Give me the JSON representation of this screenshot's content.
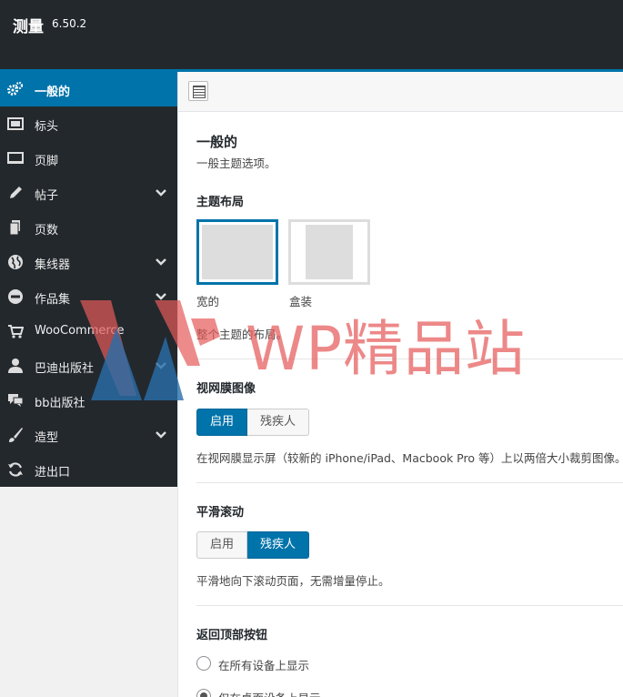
{
  "header": {
    "title": "测量",
    "version": "6.50.2"
  },
  "sidebar": {
    "items": [
      {
        "label": "一般的",
        "icon": "gears-icon",
        "active": true,
        "has_children": false
      },
      {
        "label": "标头",
        "icon": "header-icon",
        "active": false,
        "has_children": false
      },
      {
        "label": "页脚",
        "icon": "footer-icon",
        "active": false,
        "has_children": false
      },
      {
        "label": "帖子",
        "icon": "pencil-icon",
        "active": false,
        "has_children": true
      },
      {
        "label": "页数",
        "icon": "pages-icon",
        "active": false,
        "has_children": false
      },
      {
        "label": "集线器",
        "icon": "globe-icon",
        "active": false,
        "has_children": true
      },
      {
        "label": "作品集",
        "icon": "portfolio-icon",
        "active": false,
        "has_children": true
      },
      {
        "label": "WooCommerce",
        "icon": "cart-icon",
        "active": false,
        "has_children": false
      },
      {
        "label": "巴迪出版社",
        "icon": "user-icon",
        "active": false,
        "has_children": true
      },
      {
        "label": "bb出版社",
        "icon": "comments-icon",
        "active": false,
        "has_children": false
      },
      {
        "label": "造型",
        "icon": "brush-icon",
        "active": false,
        "has_children": true
      },
      {
        "label": "进出口",
        "icon": "refresh-icon",
        "active": false,
        "has_children": false
      }
    ]
  },
  "main": {
    "section_title": "一般的",
    "section_desc": "一般主题选项。",
    "layout": {
      "label": "主题布局",
      "options": [
        {
          "label": "宽的",
          "selected": true
        },
        {
          "label": "盒装",
          "selected": false
        }
      ],
      "desc": "整个主题的布局。"
    },
    "retina": {
      "label": "视网膜图像",
      "on_label": "启用",
      "off_label": "残疾人",
      "state": "on",
      "desc": "在视网膜显示屏（较新的 iPhone/iPad、Macbook Pro 等）上以两倍大小裁剪图像。"
    },
    "smooth": {
      "label": "平滑滚动",
      "on_label": "启用",
      "off_label": "残疾人",
      "state": "off",
      "desc": "平滑地向下滚动页面，无需增量停止。"
    },
    "back_to_top": {
      "label": "返回顶部按钮",
      "options": [
        {
          "label": "在所有设备上显示",
          "checked": false
        },
        {
          "label": "仅在桌面设备上显示",
          "checked": true
        }
      ]
    }
  },
  "watermark": {
    "text": "WP精品站"
  },
  "colors": {
    "accent": "#0073aa",
    "sidebar_bg": "#23282d",
    "watermark": "#e65a5a"
  }
}
